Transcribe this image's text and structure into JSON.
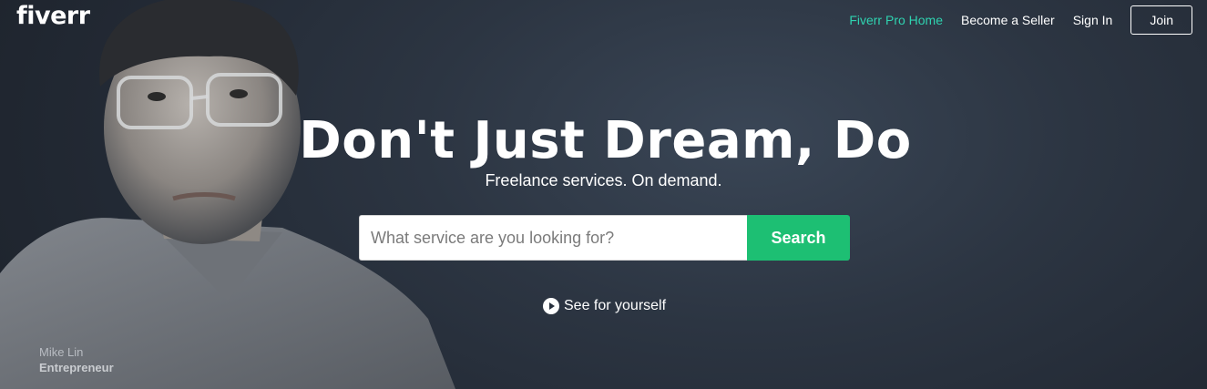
{
  "brand": {
    "logo": "fiverr"
  },
  "nav": {
    "pro_home": "Fiverr Pro Home",
    "become_seller": "Become a Seller",
    "sign_in": "Sign In",
    "join": "Join"
  },
  "hero": {
    "headline": "Don't Just Dream, Do",
    "subheadline": "Freelance services. On demand.",
    "search": {
      "placeholder": "What service are you looking for?",
      "value": "",
      "button": "Search"
    },
    "video_link": "See for yourself",
    "caption": {
      "name": "Mike Lin",
      "role": "Entrepreneur"
    }
  },
  "colors": {
    "accent": "#1dbf73",
    "pro_link": "#2fd3b0",
    "background": "#27303d"
  },
  "icons": {
    "video": "play-circle-icon"
  }
}
